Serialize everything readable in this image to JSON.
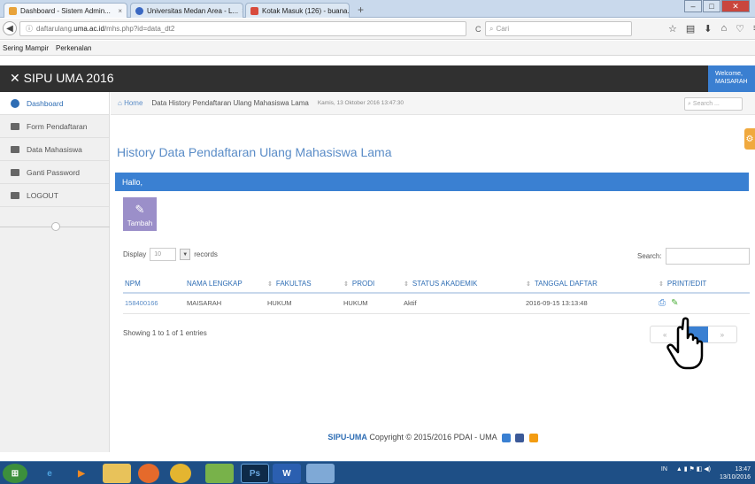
{
  "browser": {
    "tabs": [
      {
        "label": "Dashboard - Sistem Admin...",
        "close": "×"
      },
      {
        "label": "Universitas Medan Area - L...",
        "close": "×"
      },
      {
        "label": "Kotak Masuk (126) - buana...",
        "close": "×"
      }
    ],
    "new_tab": "+",
    "url_prefix": "daftarulang.",
    "url_domain": "uma.ac.id",
    "url_path": "/mhs.php?id=data_dt2",
    "search_placeholder": "Cari",
    "bookmarks": [
      "Sering Mampir",
      "Perkenalan"
    ]
  },
  "app": {
    "logo": "SIPU UMA 2016",
    "user_welcome": "Welcome,",
    "user_name": "MAISARAH"
  },
  "sidebar": {
    "items": [
      {
        "label": "Dashboard"
      },
      {
        "label": "Form Pendaftaran"
      },
      {
        "label": "Data Mahasiswa"
      },
      {
        "label": "Ganti Password"
      },
      {
        "label": "LOGOUT"
      }
    ]
  },
  "breadcrumb": {
    "home": "Home",
    "current": "Data History Pendaftaran Ulang Mahasiswa Lama",
    "date": "Kamis, 13 Oktober 2016 13:47:30",
    "search_placeholder": "Search ..."
  },
  "main": {
    "title": "History Data Pendaftaran Ulang Mahasiswa Lama",
    "hello": "Hallo,",
    "add_label": "Tambah",
    "display_label": "Display",
    "display_value": "10",
    "records_label": "records",
    "search_label": "Search:",
    "columns": [
      "NPM",
      "NAMA LENGKAP",
      "FAKULTAS",
      "PRODI",
      "STATUS AKADEMIK",
      "TANGGAL DAFTAR",
      "PRINT/EDIT"
    ],
    "rows": [
      {
        "npm": "158400166",
        "nama": "MAISARAH",
        "fakultas": "HUKUM",
        "prodi": "HUKUM",
        "status": "Aktif",
        "tanggal": "2016-09-15 13:13:48"
      }
    ],
    "showing": "Showing 1 to 1 of 1 entries",
    "pager_prev": "«",
    "pager_next": "»"
  },
  "footer": {
    "brand": "SIPU-UMA",
    "text": " Copyright © 2015/2016 PDAI - UMA"
  },
  "taskbar": {
    "time": "13:47",
    "date": "13/10/2016",
    "lang": "IN"
  }
}
